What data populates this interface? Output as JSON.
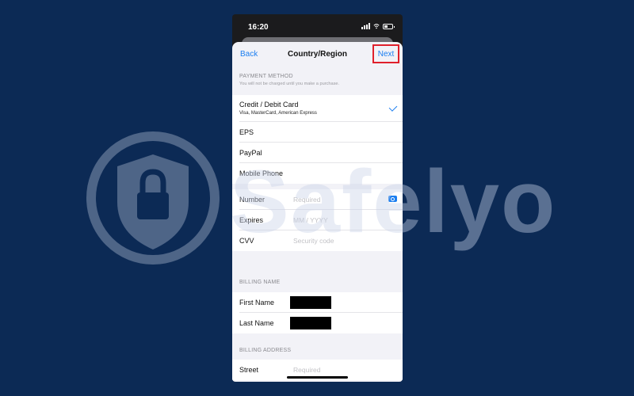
{
  "status": {
    "time": "16:20"
  },
  "nav": {
    "back": "Back",
    "title": "Country/Region",
    "next": "Next"
  },
  "payment": {
    "section_title": "PAYMENT METHOD",
    "section_note": "You will not be charged until you make a purchase.",
    "methods": [
      {
        "label": "Credit / Debit Card",
        "sub": "Visa, MasterCard, American Express",
        "selected": true
      },
      {
        "label": "EPS"
      },
      {
        "label": "PayPal"
      },
      {
        "label": "Mobile Phone"
      }
    ]
  },
  "card": {
    "number_label": "Number",
    "number_placeholder": "Required",
    "expires_label": "Expires",
    "expires_placeholder": "MM / YYYY",
    "cvv_label": "CVV",
    "cvv_placeholder": "Security code"
  },
  "billing_name": {
    "section_title": "BILLING NAME",
    "first_label": "First Name",
    "last_label": "Last Name"
  },
  "billing_address": {
    "section_title": "BILLING ADDRESS",
    "street_label": "Street",
    "street_placeholder": "Required"
  },
  "watermark": {
    "text": "Safelyo"
  },
  "colors": {
    "background": "#0c2a55",
    "accent": "#1b7ef0",
    "highlight": "#e0202b"
  },
  "icons": [
    "signal-icon",
    "wifi-icon",
    "battery-icon",
    "checkmark-icon",
    "camera-icon",
    "shield-lock-icon"
  ]
}
